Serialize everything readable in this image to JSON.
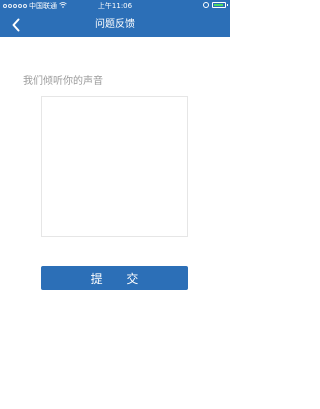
{
  "status_bar": {
    "carrier": "中国联通",
    "time": "上午11:06",
    "battery_level": 0.9,
    "wifi_icon": "wifi-icon",
    "alarm_icon": "alarm-icon"
  },
  "nav": {
    "title": "问题反馈",
    "back_icon": "back-chevron-icon"
  },
  "form": {
    "prompt": "我们倾听你的声音",
    "feedback_value": "",
    "submit_label": "提 交"
  },
  "colors": {
    "primary": "#2c6fb7",
    "prompt_text": "#9a9a9a",
    "textarea_border": "#e6e6e6",
    "battery": "#4cd964"
  }
}
